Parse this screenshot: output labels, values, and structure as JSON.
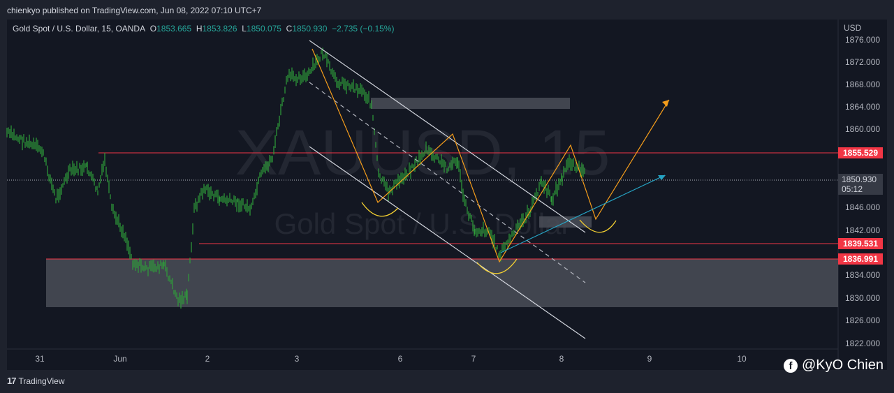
{
  "header": {
    "published": "chienkyo published on TradingView.com, Jun 08, 2022 07:10 UTC+7"
  },
  "legend": {
    "symbol": "Gold Spot / U.S. Dollar, 15, OANDA",
    "o_label": "O",
    "o": "1853.665",
    "h_label": "H",
    "h": "1853.826",
    "l_label": "L",
    "l": "1850.075",
    "c_label": "C",
    "c": "1850.930",
    "change": "−2.735 (−0.15%)"
  },
  "watermark": {
    "symbol": "XAUUSD, 15",
    "name": "Gold Spot / U.S. Dollar"
  },
  "price_axis": {
    "currency": "USD",
    "ticks": [
      "1876.000",
      "1872.000",
      "1868.000",
      "1864.000",
      "1860.000",
      "1846.000",
      "1842.000",
      "1834.000",
      "1830.000",
      "1826.000",
      "1822.000"
    ]
  },
  "time_axis": {
    "ticks": [
      "31",
      "Jun",
      "2",
      "3",
      "6",
      "7",
      "8",
      "9",
      "10"
    ]
  },
  "levels": {
    "level1": "1855.529",
    "level2": "1839.531",
    "level3": "1836.991",
    "current": "1850.930",
    "countdown": "05:12"
  },
  "colors": {
    "up": "#26a69a",
    "candle": "#2e9e3a",
    "level": "#f23645",
    "orange": "#f59d1b",
    "cyan": "#26a4c4",
    "yellow": "#f5d131"
  },
  "footer": {
    "brand": "TradingView",
    "author": "@KyO Chien"
  },
  "icons": {
    "brand": "tradingview-logo-icon",
    "author": "facebook-icon"
  }
}
